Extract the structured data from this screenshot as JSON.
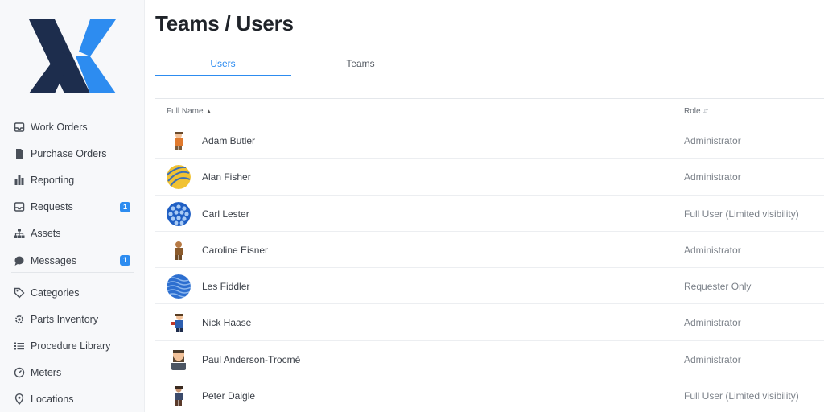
{
  "brand": {
    "logo_dark": "#1d2d4d",
    "logo_accent": "#2d8cf0"
  },
  "sidebar": {
    "primary": [
      {
        "label": "Work Orders",
        "icon": "inbox-icon"
      },
      {
        "label": "Purchase Orders",
        "icon": "document-icon"
      },
      {
        "label": "Reporting",
        "icon": "bar-chart-icon"
      },
      {
        "label": "Requests",
        "icon": "inbox-icon",
        "badge": "1"
      },
      {
        "label": "Assets",
        "icon": "hierarchy-icon"
      },
      {
        "label": "Messages",
        "icon": "chat-icon",
        "badge": "1"
      }
    ],
    "secondary": [
      {
        "label": "Categories",
        "icon": "tag-icon"
      },
      {
        "label": "Parts Inventory",
        "icon": "gear-icon"
      },
      {
        "label": "Procedure Library",
        "icon": "list-icon"
      },
      {
        "label": "Meters",
        "icon": "gauge-icon"
      },
      {
        "label": "Locations",
        "icon": "location-pin-icon"
      }
    ]
  },
  "header": {
    "title": "Teams / Users"
  },
  "tabs": [
    {
      "label": "Users",
      "active": true
    },
    {
      "label": "Teams",
      "active": false
    }
  ],
  "table": {
    "columns": {
      "name": "Full Name",
      "role": "Role"
    },
    "rows": [
      {
        "name": "Adam Butler",
        "role": "Administrator",
        "avatar": "figure-orange-icon"
      },
      {
        "name": "Alan Fisher",
        "role": "Administrator",
        "avatar": "pattern-yellow-icon"
      },
      {
        "name": "Carl Lester",
        "role": "Full User (Limited visibility)",
        "avatar": "pattern-blue-dots-icon"
      },
      {
        "name": "Caroline Eisner",
        "role": "Administrator",
        "avatar": "figure-brown-icon"
      },
      {
        "name": "Les Fiddler",
        "role": "Requester Only",
        "avatar": "pattern-blue-wave-icon"
      },
      {
        "name": "Nick Haase",
        "role": "Administrator",
        "avatar": "figure-blue-icon"
      },
      {
        "name": "Paul Anderson-Trocmé",
        "role": "Administrator",
        "avatar": "figure-bearded-icon"
      },
      {
        "name": "Peter Daigle",
        "role": "Full User (Limited visibility)",
        "avatar": "figure-dark-icon"
      }
    ]
  }
}
